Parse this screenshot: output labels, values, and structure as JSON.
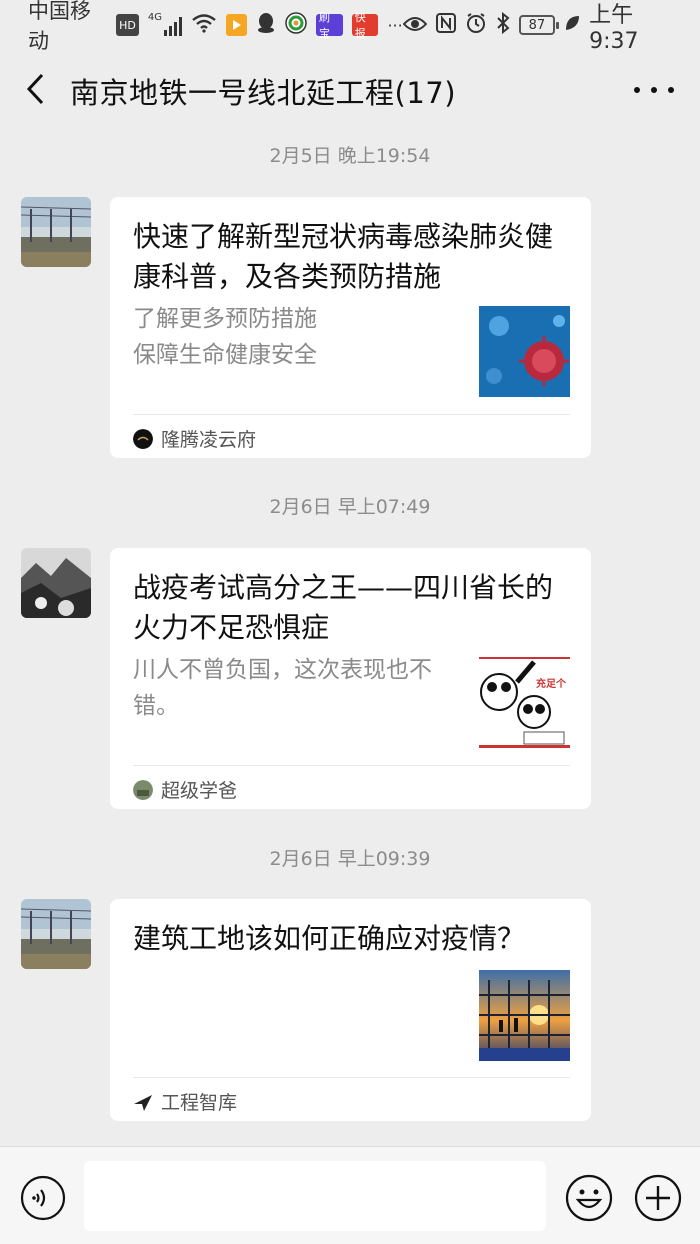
{
  "status_bar": {
    "carrier": "中国移动",
    "hd": "HD",
    "network": "4G",
    "app_icons": [
      "video-app-icon",
      "qq-icon",
      "browser-icon",
      "shuabao-icon",
      "kuaibao-icon"
    ],
    "shuabao_label": "刷宝",
    "kuaibao_label": "快报",
    "more": "···",
    "battery": "87",
    "time": "上午9:37"
  },
  "header": {
    "title": "南京地铁一号线北延工程(17)"
  },
  "messages": [
    {
      "timestamp": "2月5日 晚上19:54",
      "title": "快速了解新型冠状病毒感染肺炎健康科普，及各类预防措施",
      "description": "了解更多预防措施\n保障生命健康安全",
      "source": "隆腾凌云府",
      "thumb": "virus-image"
    },
    {
      "timestamp": "2月6日 早上07:49",
      "title": "战疫考试高分之王——四川省长的火力不足恐惧症",
      "description": "川人不曾负国，这次表现也不错。",
      "source": "超级学爸",
      "thumb": "panda-meme-image",
      "thumb_text": "充足个"
    },
    {
      "timestamp": "2月6日 早上09:39",
      "title": "建筑工地该如何正确应对疫情？",
      "description": "",
      "source": "工程智库",
      "thumb": "construction-site-image"
    }
  ],
  "input": {
    "placeholder": ""
  },
  "colors": {
    "background": "#ededed",
    "card": "#ffffff",
    "timestamp": "#8c8c8c",
    "description": "#8a8a8a"
  }
}
